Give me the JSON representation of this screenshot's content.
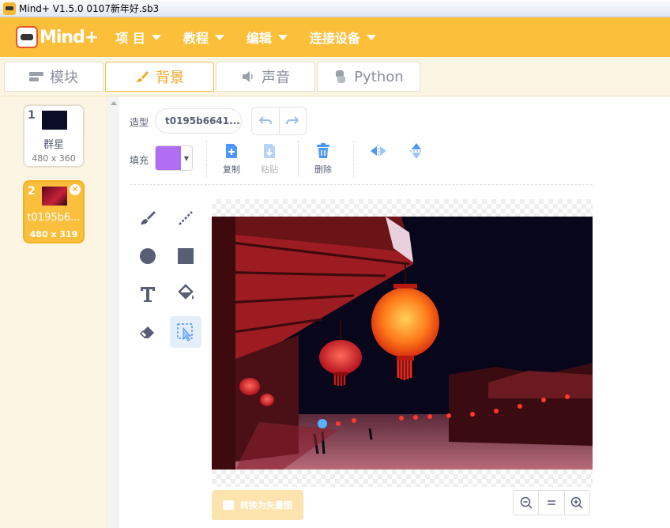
{
  "titlebar": {
    "title": "Mind+ V1.5.0     0107新年好.sb3"
  },
  "menubar": {
    "logo": "Mind+",
    "items": [
      {
        "label": "项 目"
      },
      {
        "label": "教程"
      },
      {
        "label": "编辑"
      },
      {
        "label": "连接设备"
      }
    ]
  },
  "tabs": [
    {
      "label": "模块",
      "icon": "blocks-icon"
    },
    {
      "label": "背景",
      "icon": "brush-icon",
      "active": true
    },
    {
      "label": "声音",
      "icon": "speaker-icon"
    },
    {
      "label": "Python",
      "icon": "python-icon"
    }
  ],
  "sprites": [
    {
      "num": "1",
      "name": "群星",
      "size": "480 x 360"
    },
    {
      "num": "2",
      "name": "t0195b6...",
      "size": "480 x 319",
      "selected": true
    }
  ],
  "editor": {
    "costume_label": "造型",
    "costume_name": "t0195b6641...",
    "fill_label": "填充",
    "fill_color": "#b16ef5",
    "copy_label": "复制",
    "paste_label": "粘贴",
    "delete_label": "删除",
    "convert_label": "转换为矢量图",
    "accent_color": "#fcbf3a"
  }
}
